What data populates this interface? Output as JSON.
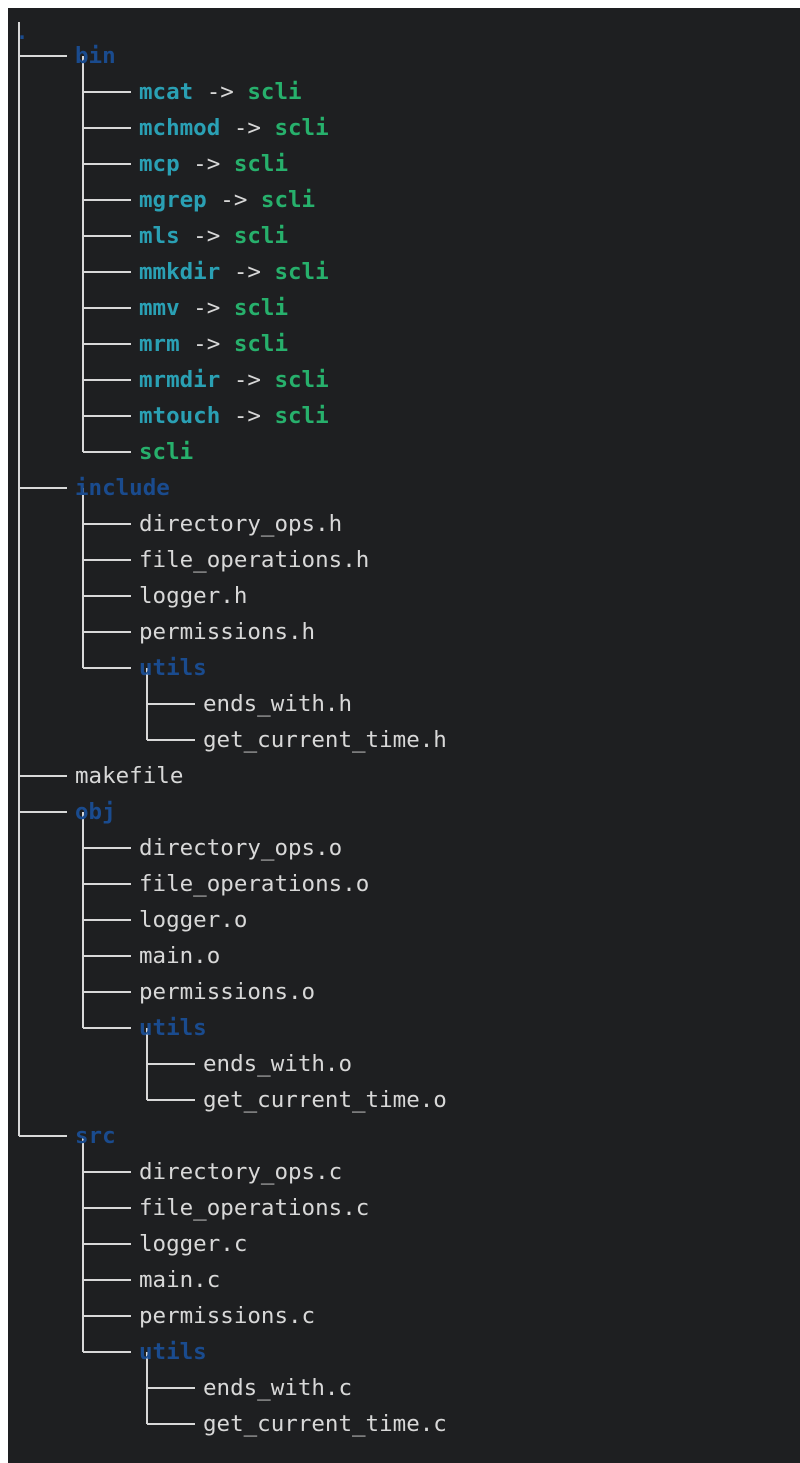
{
  "root": ".",
  "tree": [
    {
      "name": "bin",
      "type": "dir",
      "children": [
        {
          "name": "mcat",
          "type": "link",
          "target": "scli"
        },
        {
          "name": "mchmod",
          "type": "link",
          "target": "scli"
        },
        {
          "name": "mcp",
          "type": "link",
          "target": "scli"
        },
        {
          "name": "mgrep",
          "type": "link",
          "target": "scli"
        },
        {
          "name": "mls",
          "type": "link",
          "target": "scli"
        },
        {
          "name": "mmkdir",
          "type": "link",
          "target": "scli"
        },
        {
          "name": "mmv",
          "type": "link",
          "target": "scli"
        },
        {
          "name": "mrm",
          "type": "link",
          "target": "scli"
        },
        {
          "name": "mrmdir",
          "type": "link",
          "target": "scli"
        },
        {
          "name": "mtouch",
          "type": "link",
          "target": "scli"
        },
        {
          "name": "scli",
          "type": "exec"
        }
      ]
    },
    {
      "name": "include",
      "type": "dir",
      "children": [
        {
          "name": "directory_ops.h",
          "type": "file"
        },
        {
          "name": "file_operations.h",
          "type": "file"
        },
        {
          "name": "logger.h",
          "type": "file"
        },
        {
          "name": "permissions.h",
          "type": "file"
        },
        {
          "name": "utils",
          "type": "dir",
          "children": [
            {
              "name": "ends_with.h",
              "type": "file"
            },
            {
              "name": "get_current_time.h",
              "type": "file"
            }
          ]
        }
      ]
    },
    {
      "name": "makefile",
      "type": "file"
    },
    {
      "name": "obj",
      "type": "dir",
      "children": [
        {
          "name": "directory_ops.o",
          "type": "file"
        },
        {
          "name": "file_operations.o",
          "type": "file"
        },
        {
          "name": "logger.o",
          "type": "file"
        },
        {
          "name": "main.o",
          "type": "file"
        },
        {
          "name": "permissions.o",
          "type": "file"
        },
        {
          "name": "utils",
          "type": "dir",
          "children": [
            {
              "name": "ends_with.o",
              "type": "file"
            },
            {
              "name": "get_current_time.o",
              "type": "file"
            }
          ]
        }
      ]
    },
    {
      "name": "src",
      "type": "dir",
      "children": [
        {
          "name": "directory_ops.c",
          "type": "file"
        },
        {
          "name": "file_operations.c",
          "type": "file"
        },
        {
          "name": "logger.c",
          "type": "file"
        },
        {
          "name": "main.c",
          "type": "file"
        },
        {
          "name": "permissions.c",
          "type": "file"
        },
        {
          "name": "utils",
          "type": "dir",
          "children": [
            {
              "name": "ends_with.c",
              "type": "file"
            },
            {
              "name": "get_current_time.c",
              "type": "file"
            }
          ]
        }
      ]
    }
  ],
  "link_arrow": "->",
  "colors": {
    "background": "#1e1f21",
    "directory": "#1a4b8e",
    "symlink": "#2aa0b4",
    "executable": "#27b06c",
    "file": "#d8d8d8"
  }
}
